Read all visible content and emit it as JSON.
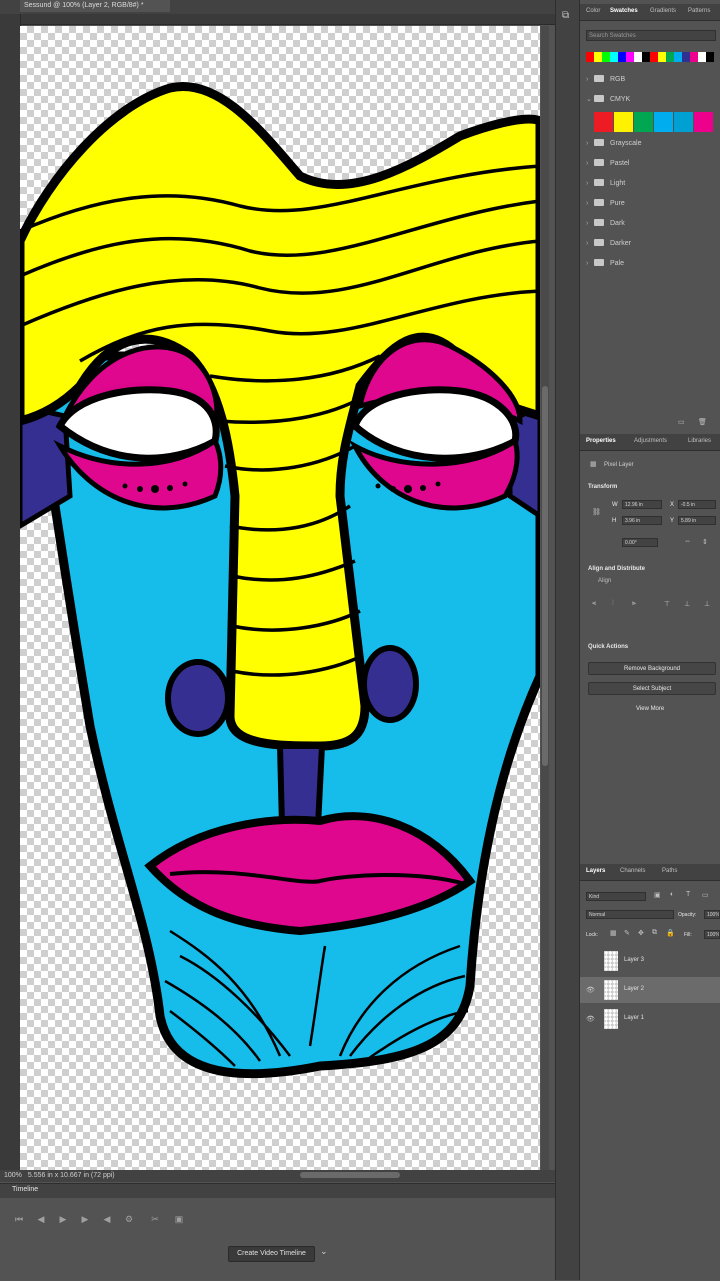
{
  "document": {
    "tab_title": "Sessund @ 100% (Layer 2, RGB/8#) *",
    "status_zoom": "100%",
    "status_info": "5.556 in x 10.667 in (72 ppi)"
  },
  "timeline": {
    "title": "Timeline",
    "create_button": "Create Video Timeline",
    "dropdown_icon": "chevron-down-icon"
  },
  "swatches_panel": {
    "tabs": [
      "Color",
      "Swatches",
      "Gradients",
      "Patterns"
    ],
    "active_tab": "Swatches",
    "search_placeholder": "Search Swatches",
    "recent_colors": [
      "#ff0000",
      "#ffff00",
      "#00ff00",
      "#00ffff",
      "#0000ff",
      "#ff00ff",
      "#ffffff",
      "#000000",
      "#ff0000",
      "#ffff00",
      "#00a651",
      "#00aeef",
      "#2e3192",
      "#ec008c",
      "#ffffff",
      "#000000"
    ],
    "groups": [
      {
        "name": "RGB",
        "expanded": false
      },
      {
        "name": "CMYK",
        "expanded": true,
        "colors": [
          "#ed1c24",
          "#fff200",
          "#00a651",
          "#00aeef",
          "#00a0d2",
          "#ec008c"
        ]
      },
      {
        "name": "Grayscale",
        "expanded": false
      },
      {
        "name": "Pastel",
        "expanded": false
      },
      {
        "name": "Light",
        "expanded": false
      },
      {
        "name": "Pure",
        "expanded": false
      },
      {
        "name": "Dark",
        "expanded": false
      },
      {
        "name": "Darker",
        "expanded": false
      },
      {
        "name": "Pale",
        "expanded": false
      }
    ]
  },
  "properties_panel": {
    "tabs": [
      "Properties",
      "Adjustments",
      "Libraries"
    ],
    "active_tab": "Properties",
    "layer_kind": "Pixel Layer",
    "transform_title": "Transform",
    "w_label": "W",
    "w_value": "12.96 in",
    "h_label": "H",
    "h_value": "3.96 in",
    "x_label": "X",
    "x_value": "-0.5 in",
    "y_label": "Y",
    "y_value": "5.89 in",
    "angle_value": "0.00°",
    "align_title": "Align and Distribute",
    "align_sub": "Align",
    "quick_actions_title": "Quick Actions",
    "quick_actions": [
      "Remove Background",
      "Select Subject",
      "View More"
    ]
  },
  "layers_panel": {
    "tabs": [
      "Layers",
      "Channels",
      "Paths"
    ],
    "active_tab": "Layers",
    "filter_kind": "Kind",
    "blend_mode": "Normal",
    "opacity_label": "Opacity:",
    "opacity_value": "100%",
    "lock_label": "Lock:",
    "fill_label": "Fill:",
    "fill_value": "100%",
    "layers": [
      {
        "name": "Layer 3",
        "visible": false,
        "selected": false
      },
      {
        "name": "Layer 2",
        "visible": true,
        "selected": true
      },
      {
        "name": "Layer 1",
        "visible": true,
        "selected": false
      }
    ]
  },
  "colors": {
    "yellow": "#ffff00",
    "cyan": "#16bdea",
    "magenta": "#e0078f",
    "indigo": "#352f92",
    "outline": "#000000"
  }
}
